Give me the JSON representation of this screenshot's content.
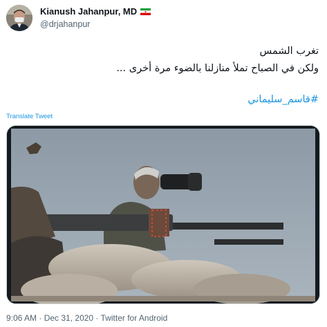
{
  "author": {
    "display_name": "Kianush Jahanpur, MD",
    "flag_icon": "iran-flag-icon",
    "handle": "@drjahanpur",
    "avatar_icon": "profile-photo"
  },
  "tweet": {
    "line1": "تغرب الشمس",
    "line2": "ولكن في الصباح تملأ منازلنا بالضوء مرة أخرى ...",
    "hashtag": "#قاسم_سليماني",
    "translate_label": "Translate Tweet"
  },
  "media": {
    "kind": "video-still",
    "subject": "man-with-binoculars-and-machine-gun"
  },
  "meta": {
    "time": "9:06 AM",
    "separator1": " · ",
    "date": "Dec 31, 2020",
    "separator2": " · ",
    "source": "Twitter for Android"
  },
  "colors": {
    "link": "#1b95e0",
    "secondary_text": "#536471",
    "primary_text": "#0f1419"
  }
}
